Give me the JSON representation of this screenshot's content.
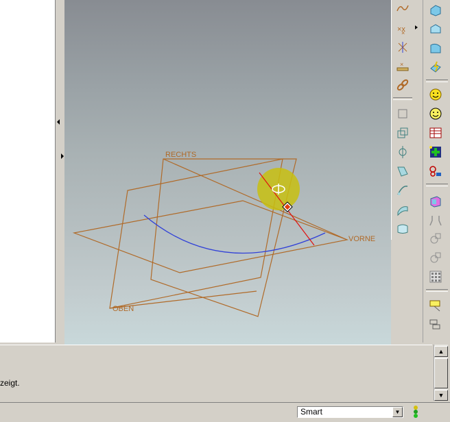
{
  "viewport": {
    "planes": {
      "right": "RECHTS",
      "front": "VORNE",
      "top": "OBEN"
    },
    "colors": {
      "plane": "#b06a28",
      "curve": "#3040d8",
      "axis": "#e01010",
      "rotate_marker": "#c8c010"
    }
  },
  "message_area": {
    "text": "zeigt."
  },
  "status_bar": {
    "selection_filter": "Smart"
  },
  "toolbar_sketch": {
    "icons": [
      "spline-icon",
      "points-icon",
      "point-cluster-icon",
      "point-array-icon",
      "chain-icon",
      "plane-icon",
      "offset-plane-icon",
      "axis-icon",
      "csys-icon",
      "curve-offset-icon",
      "surface-icon",
      "boundary-icon"
    ]
  },
  "toolbar_tools": {
    "icons": [
      "solid-block-icon",
      "solid-cylinder-icon",
      "solid-revolve-icon",
      "lightning-icon",
      "smiley-icon",
      "smiley-outline-icon",
      "table-icon",
      "green-cross-icon",
      "measure-icon",
      "pink-box-icon",
      "snap-icon",
      "circle-mirror-icon",
      "circle-copy-icon",
      "grid-icon",
      "note-icon",
      "layer-icon"
    ]
  }
}
